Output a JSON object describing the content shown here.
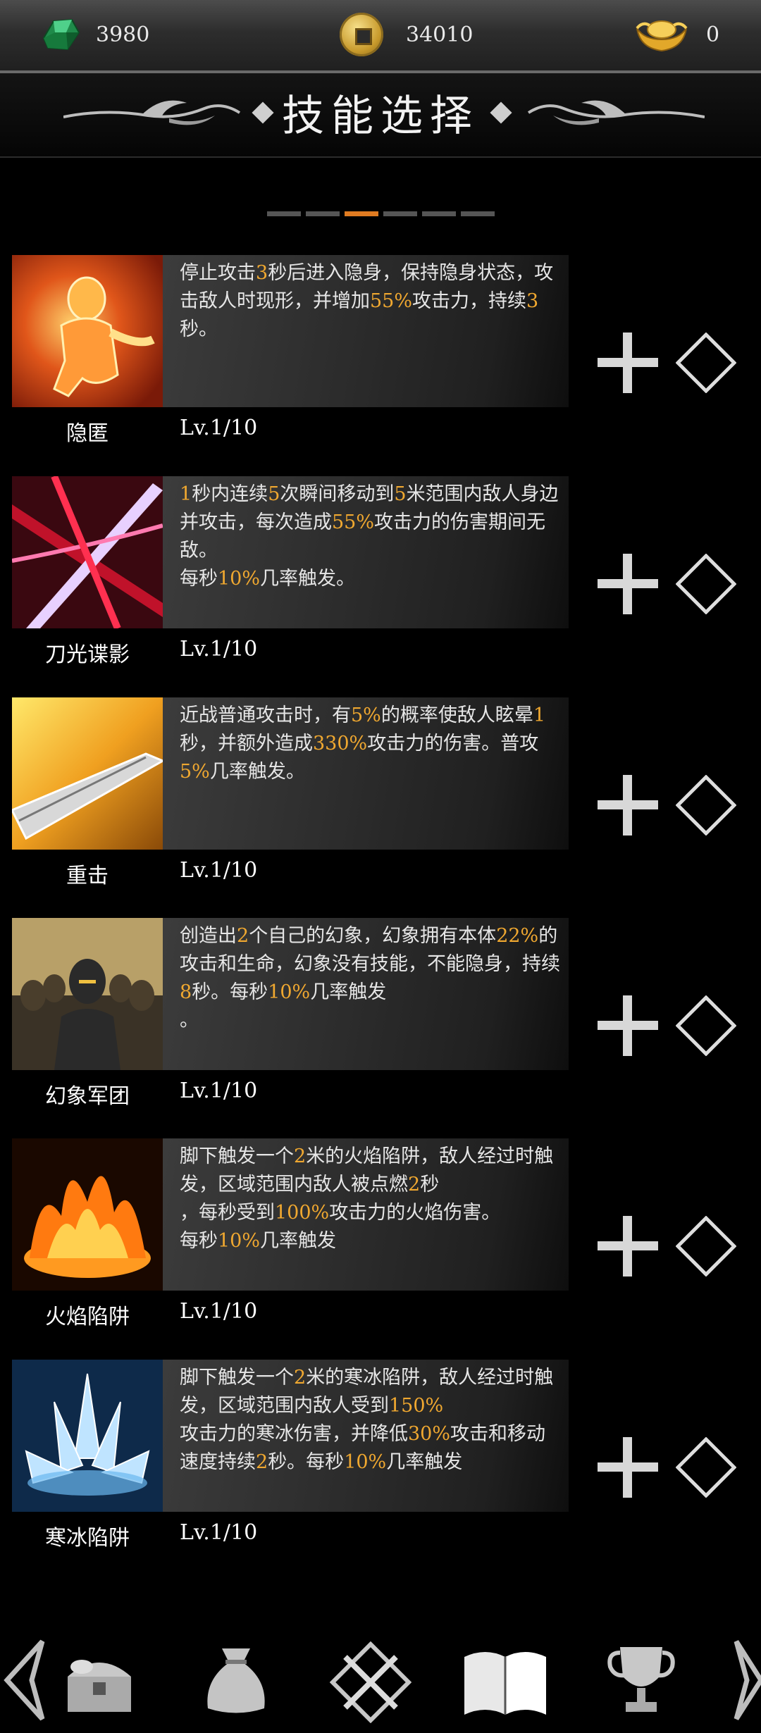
{
  "currency": {
    "gems": "3980",
    "coins": "34010",
    "ingots": "0"
  },
  "title": "技能选择",
  "pager": {
    "count": 6,
    "active": 3
  },
  "skills": [
    {
      "name": "隐匿",
      "level": "Lv.1/10",
      "desc": [
        {
          "t": "停止攻击"
        },
        {
          "t": "3",
          "h": true
        },
        {
          "t": "秒后进入隐身，保持隐身状态，攻击敌人时现形，并增加"
        },
        {
          "t": "55%",
          "h": true
        },
        {
          "t": "攻击力，持续"
        },
        {
          "t": "3",
          "h": true
        },
        {
          "t": "秒。"
        }
      ]
    },
    {
      "name": "刀光谍影",
      "level": "Lv.1/10",
      "desc": [
        {
          "t": "1",
          "h": true
        },
        {
          "t": "秒内连续"
        },
        {
          "t": "5",
          "h": true
        },
        {
          "t": "次瞬间移动到"
        },
        {
          "t": "5",
          "h": true
        },
        {
          "t": "米范围内敌人身边并攻击，每次造成"
        },
        {
          "t": "55%",
          "h": true
        },
        {
          "t": "攻击力的伤害期间无敌。\n每秒"
        },
        {
          "t": "10%",
          "h": true
        },
        {
          "t": "几率触发。"
        }
      ]
    },
    {
      "name": "重击",
      "level": "Lv.1/10",
      "desc": [
        {
          "t": "近战普通攻击时，有"
        },
        {
          "t": "5%",
          "h": true
        },
        {
          "t": "的概率使敌人眩晕"
        },
        {
          "t": "1",
          "h": true
        },
        {
          "t": "秒，并额外造成"
        },
        {
          "t": "330%",
          "h": true
        },
        {
          "t": "攻击力的伤害。普攻"
        },
        {
          "t": "5%",
          "h": true
        },
        {
          "t": "几率触发。"
        }
      ]
    },
    {
      "name": "幻象军团",
      "level": "Lv.1/10",
      "desc": [
        {
          "t": "创造出"
        },
        {
          "t": "2",
          "h": true
        },
        {
          "t": "个自己的幻象，幻象拥有本体"
        },
        {
          "t": "22%",
          "h": true
        },
        {
          "t": "的攻击和生命，幻象没有技能，不能隐身，持续"
        },
        {
          "t": "8",
          "h": true
        },
        {
          "t": "秒。每秒"
        },
        {
          "t": "10%",
          "h": true
        },
        {
          "t": "几率触发\n。"
        }
      ]
    },
    {
      "name": "火焰陷阱",
      "level": "Lv.1/10",
      "desc": [
        {
          "t": "脚下触发一个"
        },
        {
          "t": "2",
          "h": true
        },
        {
          "t": "米的火焰陷阱，敌人经过时触发，区域范围内敌人被点燃"
        },
        {
          "t": "2",
          "h": true
        },
        {
          "t": "秒\n，每秒受到"
        },
        {
          "t": "100%",
          "h": true
        },
        {
          "t": "攻击力的火焰伤害。\n每秒"
        },
        {
          "t": "10%",
          "h": true
        },
        {
          "t": "几率触发"
        }
      ]
    },
    {
      "name": "寒冰陷阱",
      "level": "Lv.1/10",
      "desc": [
        {
          "t": "脚下触发一个"
        },
        {
          "t": "2",
          "h": true
        },
        {
          "t": "米的寒冰陷阱，敌人经过时触发，区域范围内敌人受到"
        },
        {
          "t": "150%",
          "h": true
        },
        {
          "t": "\n攻击力的寒冰伤害，并降低"
        },
        {
          "t": "30%",
          "h": true
        },
        {
          "t": "攻击和移动速度持续"
        },
        {
          "t": "2",
          "h": true
        },
        {
          "t": "秒。每秒"
        },
        {
          "t": "10%",
          "h": true
        },
        {
          "t": "几率触发"
        }
      ]
    }
  ],
  "nav": [
    "left-arrow-icon",
    "treasure-chest-icon",
    "loot-bag-icon",
    "crossed-swords-icon",
    "skill-book-icon",
    "trophy-icon",
    "right-arrow-icon"
  ],
  "colors": {
    "highlight": "#f0a830",
    "pager_active": "#e07b21"
  }
}
